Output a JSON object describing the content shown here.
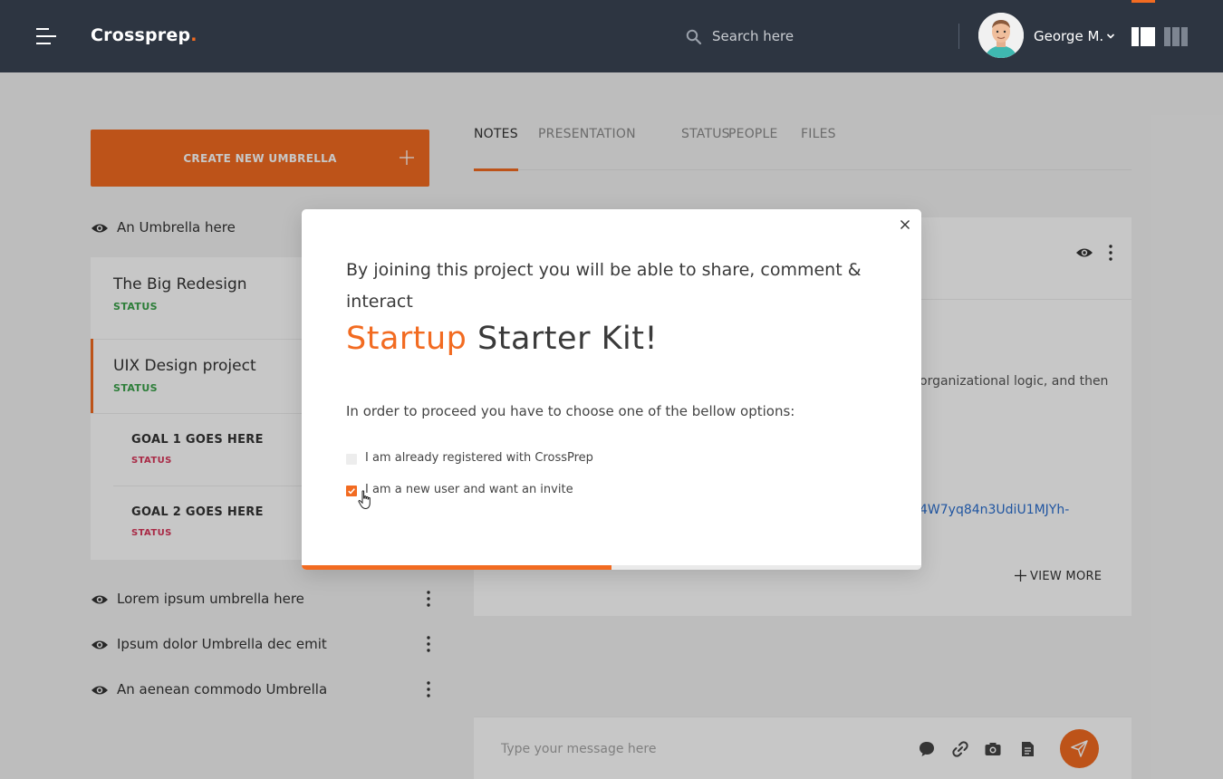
{
  "header": {
    "brand": "Crossprep",
    "brand_dot": ".",
    "search_placeholder": "Search here",
    "user_name": "George M."
  },
  "sidebar": {
    "create_label": "CREATE NEW UMBRELLA",
    "umbrellas": [
      {
        "label": "An Umbrella here"
      },
      {
        "label": "Lorem ipsum umbrella here"
      },
      {
        "label": "Ipsum dolor Umbrella dec emit"
      },
      {
        "label": "An aenean commodo Umbrella"
      }
    ],
    "projects": [
      {
        "title": "The Big Redesign",
        "status": "STATUS"
      },
      {
        "title": "UIX Design project",
        "status": "STATUS"
      }
    ],
    "goals": [
      {
        "title": "GOAL 1 GOES HERE",
        "status": "STATUS"
      },
      {
        "title": "GOAL 2 GOES HERE",
        "status": "STATUS"
      }
    ]
  },
  "tabs": [
    {
      "label": "NOTES",
      "active": true
    },
    {
      "label": "PRESENTATION",
      "active": false
    },
    {
      "label": "STATUS",
      "active": false
    },
    {
      "label": "PEOPLE",
      "active": false
    },
    {
      "label": "FILES",
      "active": false
    }
  ],
  "content": {
    "text_fragment": "organizational logic, and then",
    "link_fragment": "4W7yq84n3UdiU1MJYh-",
    "view_more": "VIEW MORE"
  },
  "message": {
    "placeholder": "Type your message here"
  },
  "modal": {
    "intro": "By joining this project you will be able to share, comment & interact",
    "title_accent": "Startup",
    "title_rest": " Starter Kit!",
    "instruction": "In order to proceed you have to choose one of the bellow options:",
    "options": [
      {
        "label": "I am already registered with CrossPrep",
        "checked": false
      },
      {
        "label": "I am a new user and want an invite",
        "checked": true
      }
    ],
    "progress_percent": 50
  },
  "colors": {
    "accent": "#f26b21",
    "header_bg": "#2d3541",
    "status_green": "#3aa24a",
    "status_red": "#d9365a",
    "link_blue": "#2b6fcf"
  },
  "icons": {
    "menu": "menu-icon",
    "search": "search-icon",
    "eye": "eye-icon",
    "kebab": "kebab-icon",
    "plus": "plus-icon",
    "close": "close-icon",
    "send": "send-icon",
    "chevron": "chevron-down-icon"
  }
}
